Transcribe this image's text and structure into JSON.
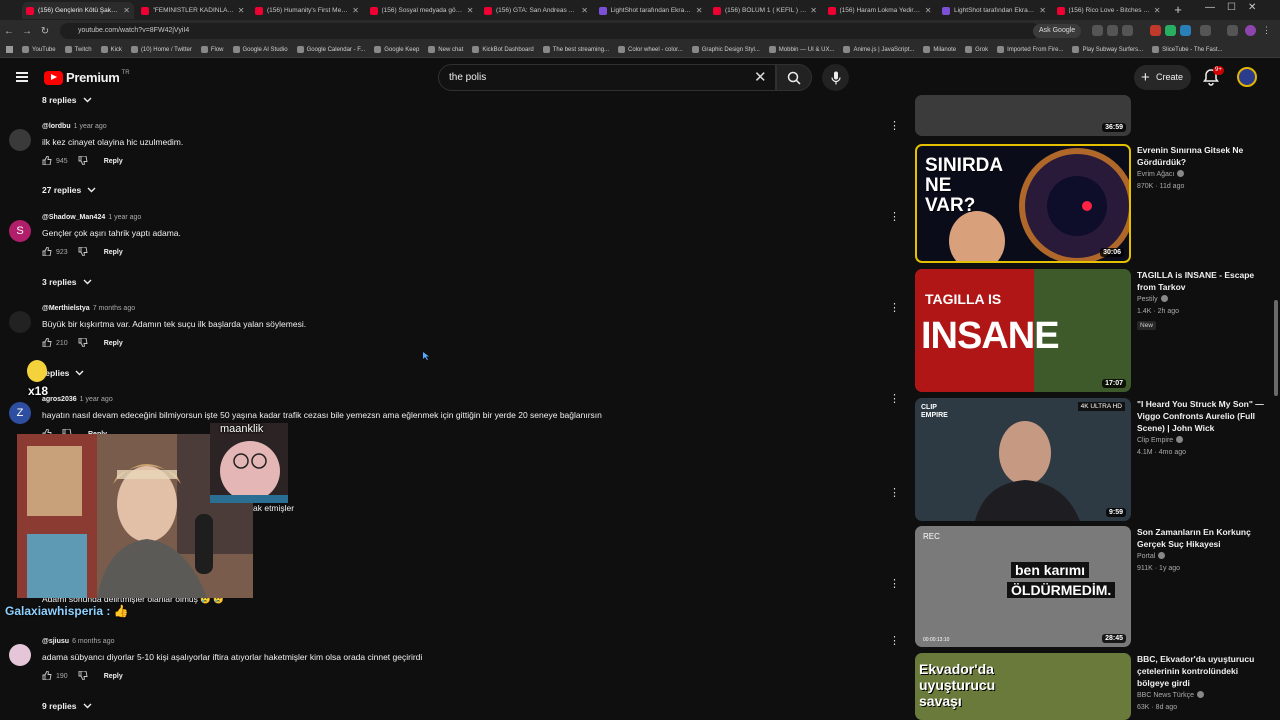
{
  "browser": {
    "tabs": [
      {
        "title": "(156) Gençlerin Kötü Şakası C..",
        "active": true,
        "fav": "youtube"
      },
      {
        "title": "\"FEMİNİSTLER KADINLARI KÖ",
        "fav": "youtube"
      },
      {
        "title": "(156) Humanity's First Mega-...",
        "fav": "youtube"
      },
      {
        "title": "(156) Sosyal medyada görüştü",
        "fav": "youtube"
      },
      {
        "title": "(156) GTA: San Andreas Türk...",
        "fav": "youtube"
      },
      {
        "title": "LightShot tarafından Ekran G...",
        "fav": "lightshot"
      },
      {
        "title": "(156) BÖLÜM 1 ( KEFİL ) - Yo..",
        "fav": "youtube"
      },
      {
        "title": "(156) Haram Lokma Yedirem...",
        "fav": "youtube"
      },
      {
        "title": "LightShot tarafından Ekran Gö",
        "fav": "lightshot"
      },
      {
        "title": "(156) Rico Love - Bitches Be...",
        "fav": "youtube"
      }
    ],
    "url": "youtube.com/watch?v=8FW42jVyiI4",
    "ask_google": "Ask Google",
    "bookmarks": [
      "YouTube",
      "Twitch",
      "Kick",
      "(10) Home / Twitter",
      "Flow",
      "Google AI Studio",
      "Google Calendar - F...",
      "Google Keep",
      "New chat",
      "KickBot Dashboard",
      "The best streaming...",
      "Color wheel - color...",
      "Graphic Design Styl...",
      "Mobbin — UI & UX...",
      "Anime.js | JavaScript...",
      "Milanote",
      "Grok",
      "Imported From Fire...",
      "Play Subway Surfers...",
      "SliceTube - The Fast..."
    ]
  },
  "header": {
    "logo_text": "Premium",
    "country": "TR",
    "search_query": "the polis",
    "create_label": "Create",
    "notif_count": "9+"
  },
  "comments": [
    {
      "kind": "replies",
      "label": "8 replies"
    },
    {
      "kind": "comment",
      "user": "@lordbu",
      "time": "1 year ago",
      "text": "ilk kez cinayet olayina hic uzulmedim.",
      "likes": "945",
      "reply": "Reply",
      "avatar": "#3a3a3a"
    },
    {
      "kind": "replies",
      "label": "27 replies"
    },
    {
      "kind": "comment",
      "user": "@Shadow_Man424",
      "time": "1 year ago",
      "text": "Gençler çok aşırı tahrik yaptı adama.",
      "likes": "923",
      "reply": "Reply",
      "avatar": "#b11f6b",
      "letter": "S"
    },
    {
      "kind": "replies",
      "label": "3 replies"
    },
    {
      "kind": "comment",
      "user": "@Merthielstya",
      "time": "7 months ago",
      "text": "Büyük bir kışkırtma var. Adamın tek suçu ilk başlarda yalan söylemesi.",
      "likes": "210",
      "reply": "Reply",
      "avatar": "#222"
    },
    {
      "kind": "replies",
      "label": "replies"
    },
    {
      "kind": "comment",
      "user": "agros2036",
      "time": "1 year ago",
      "text": "hayatın nasıl devam edeceğini bilmiyorsun işte 50 yaşına kadar trafik cezası bile yemezsn ama eğlenmek için gittiğin bir yerde 20 seneye bağlanırsın",
      "reply": "Reply",
      "avatar": "#2e4ea1",
      "letter": "Z"
    },
    {
      "kind": "partial",
      "text": "ak etmişler"
    },
    {
      "kind": "partial2",
      "text": "Adamı sonunda delirtmişler olanlar olmuş 😢 😢"
    },
    {
      "kind": "comment",
      "user": "@sjiusu",
      "time": "6 months ago",
      "text": "adama sübyancı diyorlar 5-10 kişi aşalıyorlar iftira atıyorlar haketmişler kim olsa orada cinnet geçirirdi",
      "likes": "190",
      "reply": "Reply",
      "avatar": "#e5c6d8"
    },
    {
      "kind": "replies",
      "label": "9 replies"
    }
  ],
  "sidebar": {
    "videos": [
      {
        "title": "",
        "channel": "",
        "meta": "",
        "duration": "36:59"
      },
      {
        "title": "Evrenin Sınırına Gitsek Ne Gördürdük?",
        "channel": "Evrim Ağacı",
        "meta": "870K · 11d ago",
        "duration": "30:06",
        "thumb_text": "SINIRDA NE VAR?"
      },
      {
        "title": "TAGILLA is INSANE - Escape from Tarkov",
        "channel": "Pestily",
        "meta": "1.4K · 2h ago",
        "badge": "New",
        "duration": "17:07",
        "thumb_text1": "TAGILLA IS",
        "thumb_text2": "INSANE"
      },
      {
        "title": "\"I Heard You Struck My Son\" — Viggo Confronts Aurelio (Full Scene) | John Wick",
        "channel": "Clip Empire",
        "meta": "4.1M · 4mo ago",
        "duration": "9:59",
        "thumb_tag": "4K ULTRA HD",
        "thumb_logo": "CLIP EMPIRE"
      },
      {
        "title": "Son Zamanların En Korkunç Gerçek Suç Hikayesi",
        "channel": "Portal",
        "meta": "911K · 1y ago",
        "duration": "28:45",
        "thumb_text1": "ben karımı",
        "thumb_text2": "ÖLDÜRMEDİM.",
        "thumb_rec": "REC",
        "thumb_timecode": "00:00:13:10"
      },
      {
        "title": "BBC, Ekvador'da uyuşturucu çetelerinin kontrolündeki bölgeye girdi",
        "channel": "BBC News Türkçe",
        "meta": "63K · 8d ago",
        "thumb_text": "Ekvador'da uyuşturucu savaşı"
      }
    ]
  },
  "overlay": {
    "cam_label": "maanklik",
    "chat_user": "Galaxiawhisperia",
    "emote_count": "x18"
  }
}
